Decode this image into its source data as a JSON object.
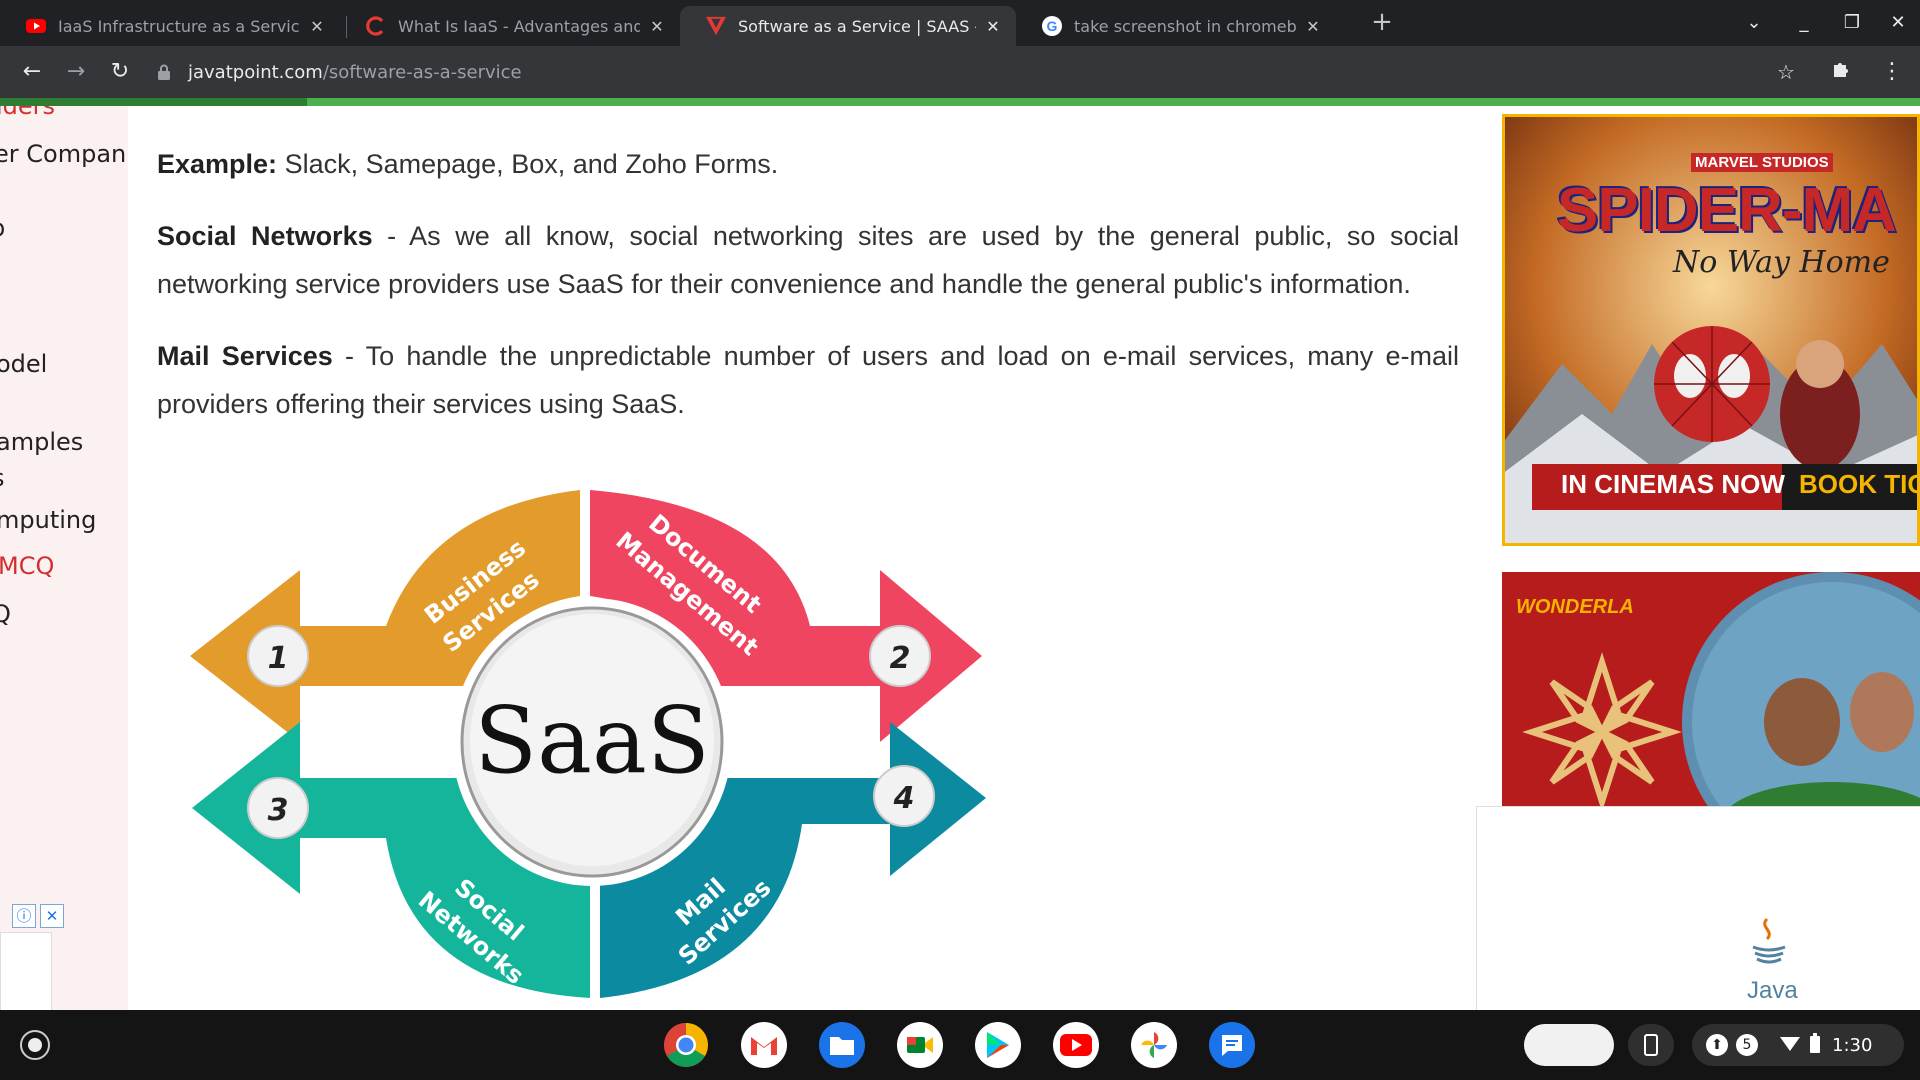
{
  "browser": {
    "tabs": [
      {
        "title": "IaaS Infrastructure as a Service, C",
        "active": false,
        "favicon": "youtube-icon"
      },
      {
        "title": "What Is IaaS - Advantages and D",
        "active": false,
        "favicon": "c-logo-icon"
      },
      {
        "title": "Software as a Service | SAAS - ja",
        "active": true,
        "favicon": "javatpoint-icon"
      },
      {
        "title": "take screenshot in chromebook",
        "active": false,
        "favicon": "google-icon"
      }
    ],
    "url_domain": "javatpoint.com",
    "url_path": "/software-as-a-service",
    "progress_fraction": 0.16
  },
  "sidebar": {
    "items": [
      {
        "label": "iders",
        "style": "red"
      },
      {
        "label": "er Companie",
        "style": "normal"
      },
      {
        "label": "b",
        "style": "normal"
      },
      {
        "label": "odel",
        "style": "normal"
      },
      {
        "label": "amples",
        "style": "normal"
      },
      {
        "label": "s",
        "style": "normal"
      },
      {
        "label": "mputing",
        "style": "normal"
      },
      {
        "label": "MCQ",
        "style": "red"
      },
      {
        "label": "Q",
        "style": "normal"
      }
    ]
  },
  "content": {
    "example_label": "Example:",
    "example_text": " Slack, Samepage, Box, and Zoho Forms.",
    "social_label": "Social Networks",
    "social_text": " - As we all know, social networking sites are used by the general public, so social networking service providers use SaaS for their convenience and handle the general public's information.",
    "mail_label": "Mail Services",
    "mail_text": " - To handle the unpredictable number of users and load on e-mail services, many e-mail providers offering their services using SaaS."
  },
  "diagram": {
    "center": "SaaS",
    "segments": [
      {
        "number": "1",
        "line1": "Business",
        "line2": "Services",
        "color": "#e39c2c"
      },
      {
        "number": "2",
        "line1": "Document",
        "line2": "Management",
        "color": "#ef4560"
      },
      {
        "number": "3",
        "line1": "Social",
        "line2": "Networks",
        "color": "#14b59a"
      },
      {
        "number": "4",
        "line1": "Mail",
        "line2": "Services",
        "color": "#0b8aa0"
      }
    ]
  },
  "ads": {
    "spiderman": {
      "brand": "MARVEL STUDIOS",
      "title": "SPIDER-MA",
      "subtitle": "No Way Home",
      "cta_left": "IN CINEMAS NOW",
      "cta_right": "BOOK TICK"
    },
    "wonderla": {
      "brand": "WONDERLA"
    },
    "video_watermark": "Java"
  },
  "shelf": {
    "apps": [
      "chrome-icon",
      "gmail-icon",
      "files-icon",
      "meet-icon",
      "play-store-icon",
      "youtube-icon",
      "photos-icon",
      "messages-icon"
    ],
    "notification_count": "5",
    "time": "1:30"
  }
}
